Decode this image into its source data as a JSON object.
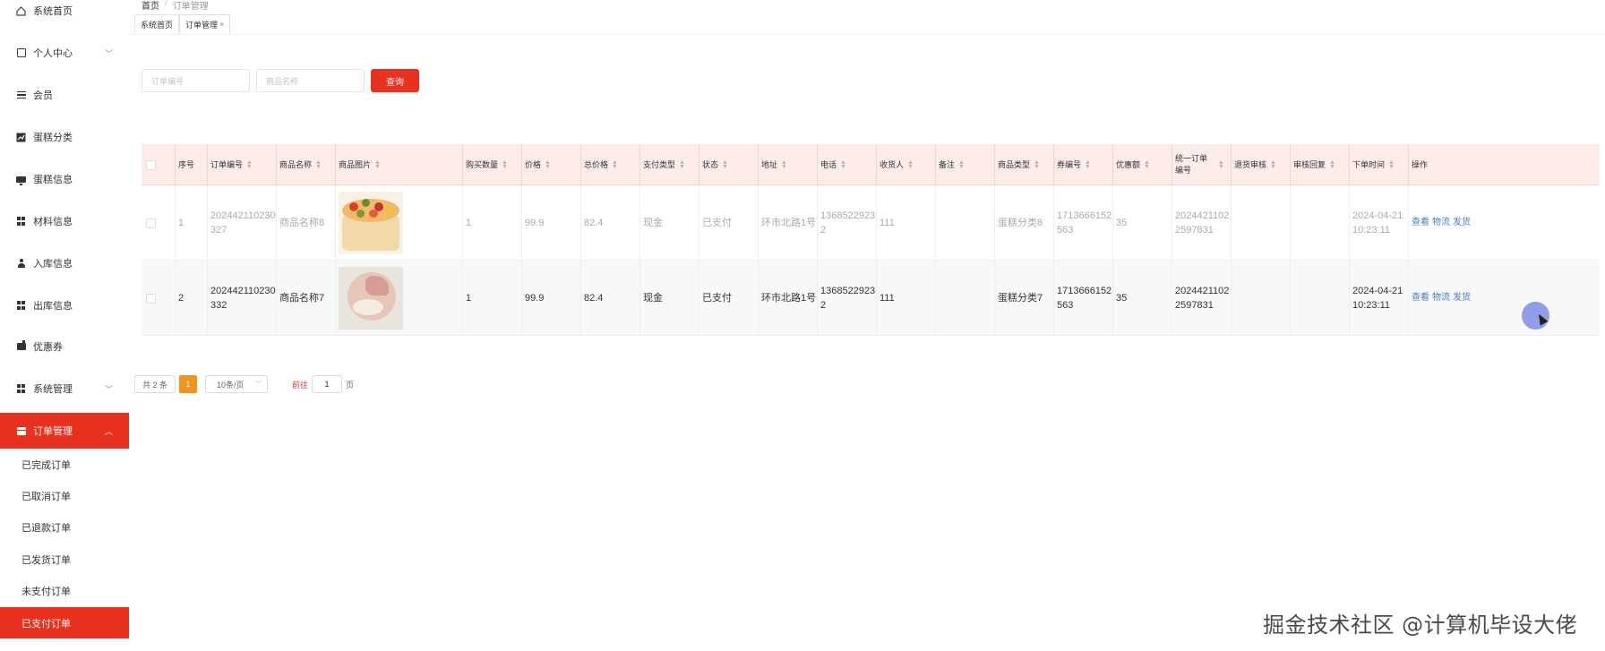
{
  "sidebar": {
    "items": [
      {
        "label": "系统首页",
        "icon": "home-icon"
      },
      {
        "label": "个人中心",
        "icon": "panel-icon",
        "expandable": true
      },
      {
        "label": "会员",
        "icon": "list-icon"
      },
      {
        "label": "蛋糕分类",
        "icon": "chart-icon"
      },
      {
        "label": "蛋糕信息",
        "icon": "monitor-icon"
      },
      {
        "label": "材料信息",
        "icon": "grid-icon"
      },
      {
        "label": "入库信息",
        "icon": "user-icon"
      },
      {
        "label": "出库信息",
        "icon": "grid-icon"
      },
      {
        "label": "优惠券",
        "icon": "coupon-icon"
      },
      {
        "label": "系统管理",
        "icon": "grid-icon",
        "expandable": true
      },
      {
        "label": "订单管理",
        "icon": "table-icon",
        "expandable": true,
        "active": true
      }
    ],
    "submenu": [
      {
        "label": "已完成订单"
      },
      {
        "label": "已取消订单"
      },
      {
        "label": "已退款订单"
      },
      {
        "label": "已发货订单"
      },
      {
        "label": "未支付订单"
      },
      {
        "label": "已支付订单",
        "active": true
      }
    ]
  },
  "breadcrumb": {
    "home": "首页",
    "sep": "/",
    "current": "订单管理"
  },
  "tabs": [
    {
      "label": "系统首页"
    },
    {
      "label": "订单管理",
      "close": "×",
      "active": true
    }
  ],
  "search": {
    "order_no_placeholder": "订单编号",
    "product_name_placeholder": "商品名称",
    "button_label": "查询"
  },
  "table": {
    "columns": [
      "序号",
      "订单编号",
      "商品名称",
      "商品图片",
      "购买数量",
      "价格",
      "总价格",
      "支付类型",
      "状态",
      "地址",
      "电话",
      "收货人",
      "备注",
      "商品类型",
      "券编号",
      "优惠额",
      "统一订单编号",
      "退货审核",
      "审核回复",
      "下单时间",
      "操作"
    ],
    "rows": [
      {
        "index": "1",
        "order_no": "202442110230327",
        "product_name": "商品名称8",
        "qty": "1",
        "price": "99.9",
        "total": "82.4",
        "pay_type": "现金",
        "status": "已支付",
        "address": "环市北路1号",
        "phone": "13685229232",
        "receiver": "111",
        "remark": "",
        "category": "蛋糕分类8",
        "coupon_no": "1713666152563",
        "discount": "35",
        "unified_no": "20244211022597831",
        "return_review": "",
        "review_reply": "",
        "time": "2024-04-21 10:23:11"
      },
      {
        "index": "2",
        "order_no": "202442110230332",
        "product_name": "商品名称7",
        "qty": "1",
        "price": "99.9",
        "total": "82.4",
        "pay_type": "现金",
        "status": "已支付",
        "address": "环市北路1号",
        "phone": "13685229232",
        "receiver": "111",
        "remark": "",
        "category": "蛋糕分类7",
        "coupon_no": "1713666152563",
        "discount": "35",
        "unified_no": "20244211022597831",
        "return_review": "",
        "review_reply": "",
        "time": "2024-04-21 10:23:11"
      }
    ],
    "actions": [
      "查看",
      "物流",
      "发货"
    ]
  },
  "pagination": {
    "total": "共 2 条",
    "current_page": "1",
    "page_size": "10条/页",
    "goto_prefix": "前往",
    "goto_value": "1",
    "goto_suffix": "页"
  },
  "watermark": "掘金技术社区 @计算机毕设大佬",
  "colors": {
    "accent": "#e8311f",
    "header_bg": "#fdecea",
    "pager_active": "#f0951f",
    "link": "#4a7fc1"
  }
}
